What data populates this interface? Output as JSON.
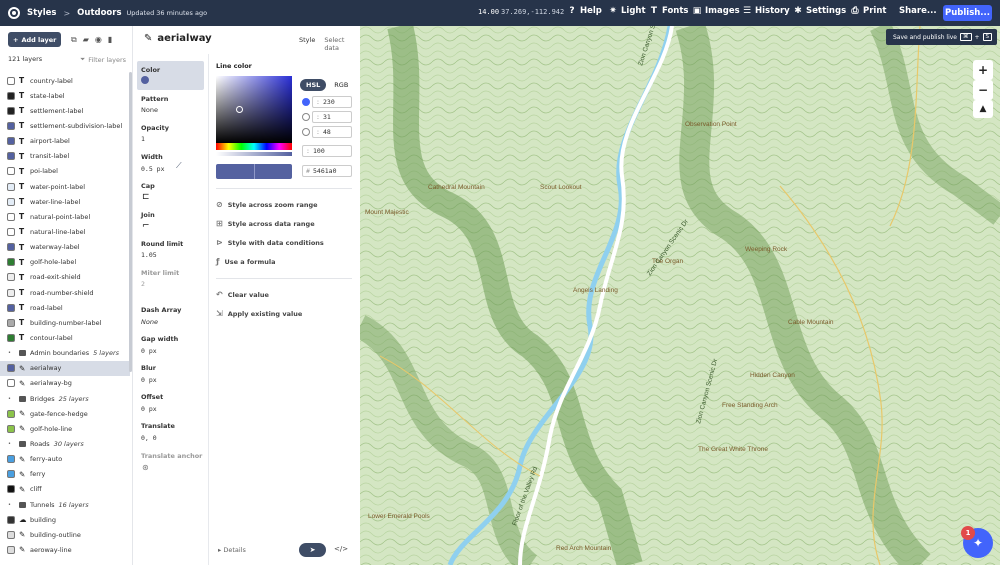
{
  "topbar": {
    "crumb_styles": "Styles",
    "crumb_sep": ">",
    "crumb_style_name": "Outdoors",
    "updated": "Updated 36 minutes ago",
    "zoom": "14.00",
    "coords": "37.269,-112.942",
    "help": "Help",
    "light": "Light",
    "fonts": "Fonts",
    "images": "Images",
    "history": "History",
    "settings": "Settings",
    "print": "Print",
    "share": "Share...",
    "publish": "Publish..."
  },
  "left": {
    "add_layer": "Add layer",
    "layer_count": "121 layers",
    "filter": "Filter layers",
    "layers": [
      {
        "name": "country-label",
        "kind": "symbol",
        "color": "#ffffff"
      },
      {
        "name": "state-label",
        "kind": "symbol",
        "color": "#222222"
      },
      {
        "name": "settlement-label",
        "kind": "symbol",
        "color": "#222222"
      },
      {
        "name": "settlement-subdivision-label",
        "kind": "symbol",
        "color": "#5461a0"
      },
      {
        "name": "airport-label",
        "kind": "symbol",
        "color": "#5461a0"
      },
      {
        "name": "transit-label",
        "kind": "symbol",
        "color": "#5461a0"
      },
      {
        "name": "poi-label",
        "kind": "symbol",
        "color": "#ffffff"
      },
      {
        "name": "water-point-label",
        "kind": "symbol",
        "color": "#e4edf7"
      },
      {
        "name": "water-line-label",
        "kind": "symbol",
        "color": "#e4edf7"
      },
      {
        "name": "natural-point-label",
        "kind": "symbol",
        "color": "#ffffff"
      },
      {
        "name": "natural-line-label",
        "kind": "symbol",
        "color": "#ffffff"
      },
      {
        "name": "waterway-label",
        "kind": "symbol",
        "color": "#5461a0"
      },
      {
        "name": "golf-hole-label",
        "kind": "symbol",
        "color": "#2e7d32"
      },
      {
        "name": "road-exit-shield",
        "kind": "symbol",
        "color": "#eeeeee"
      },
      {
        "name": "road-number-shield",
        "kind": "symbol",
        "color": "#eeeeee"
      },
      {
        "name": "road-label",
        "kind": "symbol",
        "color": "#5461a0"
      },
      {
        "name": "building-number-label",
        "kind": "symbol",
        "color": "#aaaaaa"
      },
      {
        "name": "contour-label",
        "kind": "symbol",
        "color": "#2e7d32"
      },
      {
        "name": "Admin boundaries",
        "kind": "group",
        "count": "5 layers"
      },
      {
        "name": "aerialway",
        "kind": "line",
        "color": "#5461a0",
        "selected": true
      },
      {
        "name": "aerialway-bg",
        "kind": "line",
        "color": "#ffffff"
      },
      {
        "name": "Bridges",
        "kind": "group",
        "count": "25 layers"
      },
      {
        "name": "gate-fence-hedge",
        "kind": "line",
        "color": "#8bc34a"
      },
      {
        "name": "golf-hole-line",
        "kind": "line",
        "color": "#8bc34a"
      },
      {
        "name": "Roads",
        "kind": "group",
        "count": "30 layers"
      },
      {
        "name": "ferry-auto",
        "kind": "line",
        "color": "#4a9fe0"
      },
      {
        "name": "ferry",
        "kind": "line",
        "color": "#4a9fe0"
      },
      {
        "name": "cliff",
        "kind": "line",
        "color": "#111111"
      },
      {
        "name": "Tunnels",
        "kind": "group",
        "count": "16 layers"
      },
      {
        "name": "building",
        "kind": "fill",
        "color": "#333333"
      },
      {
        "name": "building-outline",
        "kind": "line",
        "color": "#dddddd"
      },
      {
        "name": "aeroway-line",
        "kind": "line",
        "color": "#dddddd"
      }
    ]
  },
  "mid": {
    "layer_name": "aerialway",
    "tab_style": "Style",
    "tab_select": "Select data",
    "props": {
      "color": "Color",
      "pattern": "Pattern",
      "pattern_val": "None",
      "opacity": "Opacity",
      "opacity_val": "1",
      "width": "Width",
      "width_val": "0.5 px",
      "cap": "Cap",
      "join": "Join",
      "round_limit": "Round limit",
      "round_limit_val": "1.05",
      "miter_limit": "Miter limit",
      "miter_limit_val": "2",
      "dash_array": "Dash Array",
      "dash_array_val": "None",
      "gap_width": "Gap width",
      "gap_width_val": "0 px",
      "blur": "Blur",
      "blur_val": "0 px",
      "offset": "Offset",
      "offset_val": "0 px",
      "translate": "Translate",
      "translate_val": "0, 0",
      "translate_anchor": "Translate anchor"
    },
    "editor": {
      "label": "Line color",
      "hsl": "HSL",
      "rgb": "RGB",
      "h": "230",
      "s": "31",
      "l": "48",
      "a": "100",
      "hex": "5461a0",
      "opt1": "Style across zoom range",
      "opt2": "Style across data range",
      "opt3": "Style with data conditions",
      "opt4": "Use a formula",
      "clear": "Clear value",
      "apply": "Apply existing value"
    },
    "details": "Details",
    "code_icon": "</>"
  },
  "map": {
    "tooltip": "Save and publish live",
    "tooltip_k1": "⌘",
    "tooltip_plus": "+",
    "tooltip_k2": "S",
    "badge": "1",
    "labels": [
      {
        "t": "Zion Canyon Scenic Dr",
        "r": -72
      },
      {
        "t": "Observation Point",
        "r": 0
      },
      {
        "t": "Cathedral Mountain",
        "r": 0
      },
      {
        "t": "Scout Lookout",
        "r": 0
      },
      {
        "t": "Mount Majestic",
        "r": 0
      },
      {
        "t": "Weeping Rock",
        "r": 0
      },
      {
        "t": "The Organ",
        "r": 0
      },
      {
        "t": "Angels Landing",
        "r": 0
      },
      {
        "t": "Zion Canyon Scenic Dr",
        "r": -55
      },
      {
        "t": "Cable Mountain",
        "r": 0
      },
      {
        "t": "Hidden Canyon",
        "r": 0
      },
      {
        "t": "Zion Canyon Scenic Dr",
        "r": -75
      },
      {
        "t": "Free Standing Arch",
        "r": 0
      },
      {
        "t": "The Great White Throne",
        "r": 0
      },
      {
        "t": "Lower Emerald Pools",
        "r": 0
      },
      {
        "t": "Floor of the Valley Rd",
        "r": -70
      },
      {
        "t": "Red Arch Mountain",
        "r": 0
      }
    ]
  }
}
